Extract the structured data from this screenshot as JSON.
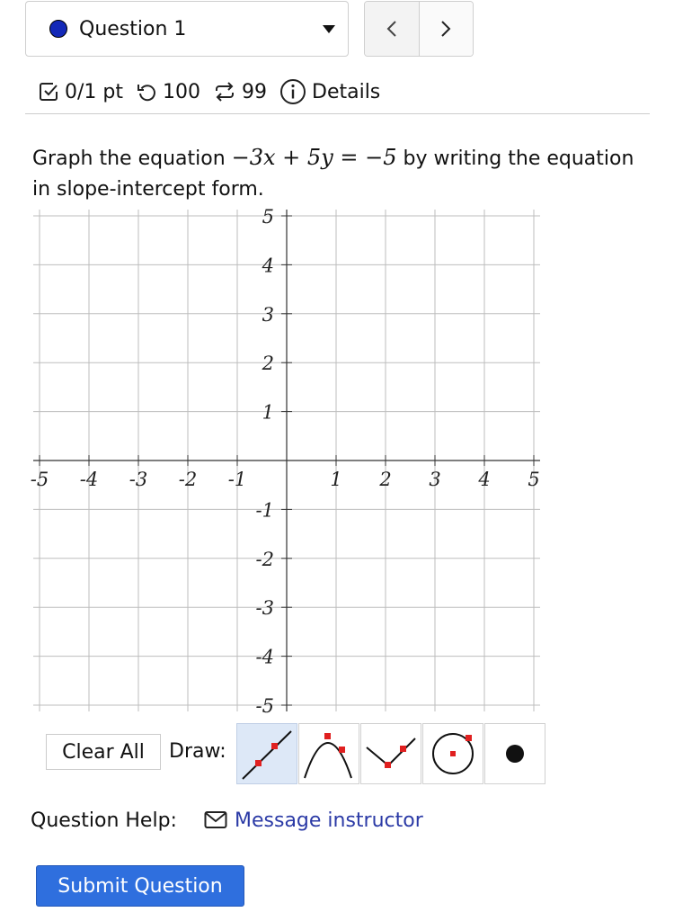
{
  "question_selector": {
    "label": "Question 1",
    "dot_color": "#1429b8"
  },
  "nav": {
    "prev": "<",
    "next": ">"
  },
  "meta": {
    "score": "0/1 pt",
    "attempts": "100",
    "retries": "99",
    "details": "Details"
  },
  "prompt": {
    "before": "Graph the equation ",
    "equation": "−3x + 5y = −5",
    "after": " by writing the equation in slope-intercept form."
  },
  "graph": {
    "xmin": -5,
    "xmax": 5,
    "ymin": -5,
    "ymax": 5,
    "x_ticks": [
      "-5",
      "-4",
      "-3",
      "-2",
      "-1",
      "1",
      "2",
      "3",
      "4",
      "5"
    ],
    "y_ticks": [
      "5",
      "4",
      "3",
      "2",
      "1",
      "-1",
      "-2",
      "-3",
      "-4",
      "-5"
    ],
    "grid": true
  },
  "toolbar": {
    "clear_label": "Clear All",
    "draw_label": "Draw:",
    "tools": [
      {
        "icon": "line-tool-icon",
        "active": true
      },
      {
        "icon": "parabola-tool-icon",
        "active": false
      },
      {
        "icon": "absolute-value-tool-icon",
        "active": false
      },
      {
        "icon": "circle-tool-icon",
        "active": false
      },
      {
        "icon": "point-tool-icon",
        "active": false
      }
    ],
    "marker_color": "#e02020"
  },
  "help": {
    "label": "Question Help:",
    "link": "Message instructor"
  },
  "submit": {
    "label": "Submit Question"
  }
}
